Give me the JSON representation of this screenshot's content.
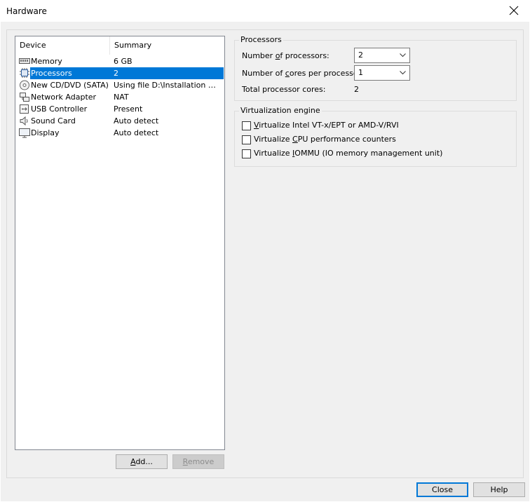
{
  "window": {
    "title": "Hardware"
  },
  "device_list": {
    "columns": {
      "device": "Device",
      "summary": "Summary"
    },
    "items": [
      {
        "name": "Memory",
        "summary": "6 GB",
        "icon": "memory-icon"
      },
      {
        "name": "Processors",
        "summary": "2",
        "icon": "processor-icon",
        "selected": true
      },
      {
        "name": "New CD/DVD (SATA)",
        "summary": "Using file D:\\Installation files...",
        "icon": "cd-dvd-icon"
      },
      {
        "name": "Network Adapter",
        "summary": "NAT",
        "icon": "network-adapter-icon"
      },
      {
        "name": "USB Controller",
        "summary": "Present",
        "icon": "usb-icon"
      },
      {
        "name": "Sound Card",
        "summary": "Auto detect",
        "icon": "speaker-icon"
      },
      {
        "name": "Display",
        "summary": "Auto detect",
        "icon": "monitor-icon"
      }
    ]
  },
  "buttons": {
    "add_pre": "",
    "add_mnemonic": "A",
    "add_rest": "dd...",
    "remove_mnemonic": "R",
    "remove_rest": "emove",
    "close": "Close",
    "help": "Help"
  },
  "processors": {
    "group_title": "Processors",
    "num_processors_label_pre": "Number ",
    "num_processors_label_mn": "o",
    "num_processors_label_post": "f processors:",
    "num_processors_value": "2",
    "cores_label_pre": "Number of ",
    "cores_label_mn": "c",
    "cores_label_post": "ores per processor:",
    "cores_value": "1",
    "total_label": "Total processor cores:",
    "total_value": "2"
  },
  "virtualization": {
    "group_title": "Virtualization engine",
    "options": [
      {
        "pre": "",
        "mn": "V",
        "post": "irtualize Intel VT-x/EPT or AMD-V/RVI",
        "checked": false
      },
      {
        "pre": "Virtualize ",
        "mn": "C",
        "post": "PU performance counters",
        "checked": false
      },
      {
        "pre": "Virtualize ",
        "mn": "I",
        "post": "OMMU (IO memory management unit)",
        "checked": false
      }
    ]
  }
}
